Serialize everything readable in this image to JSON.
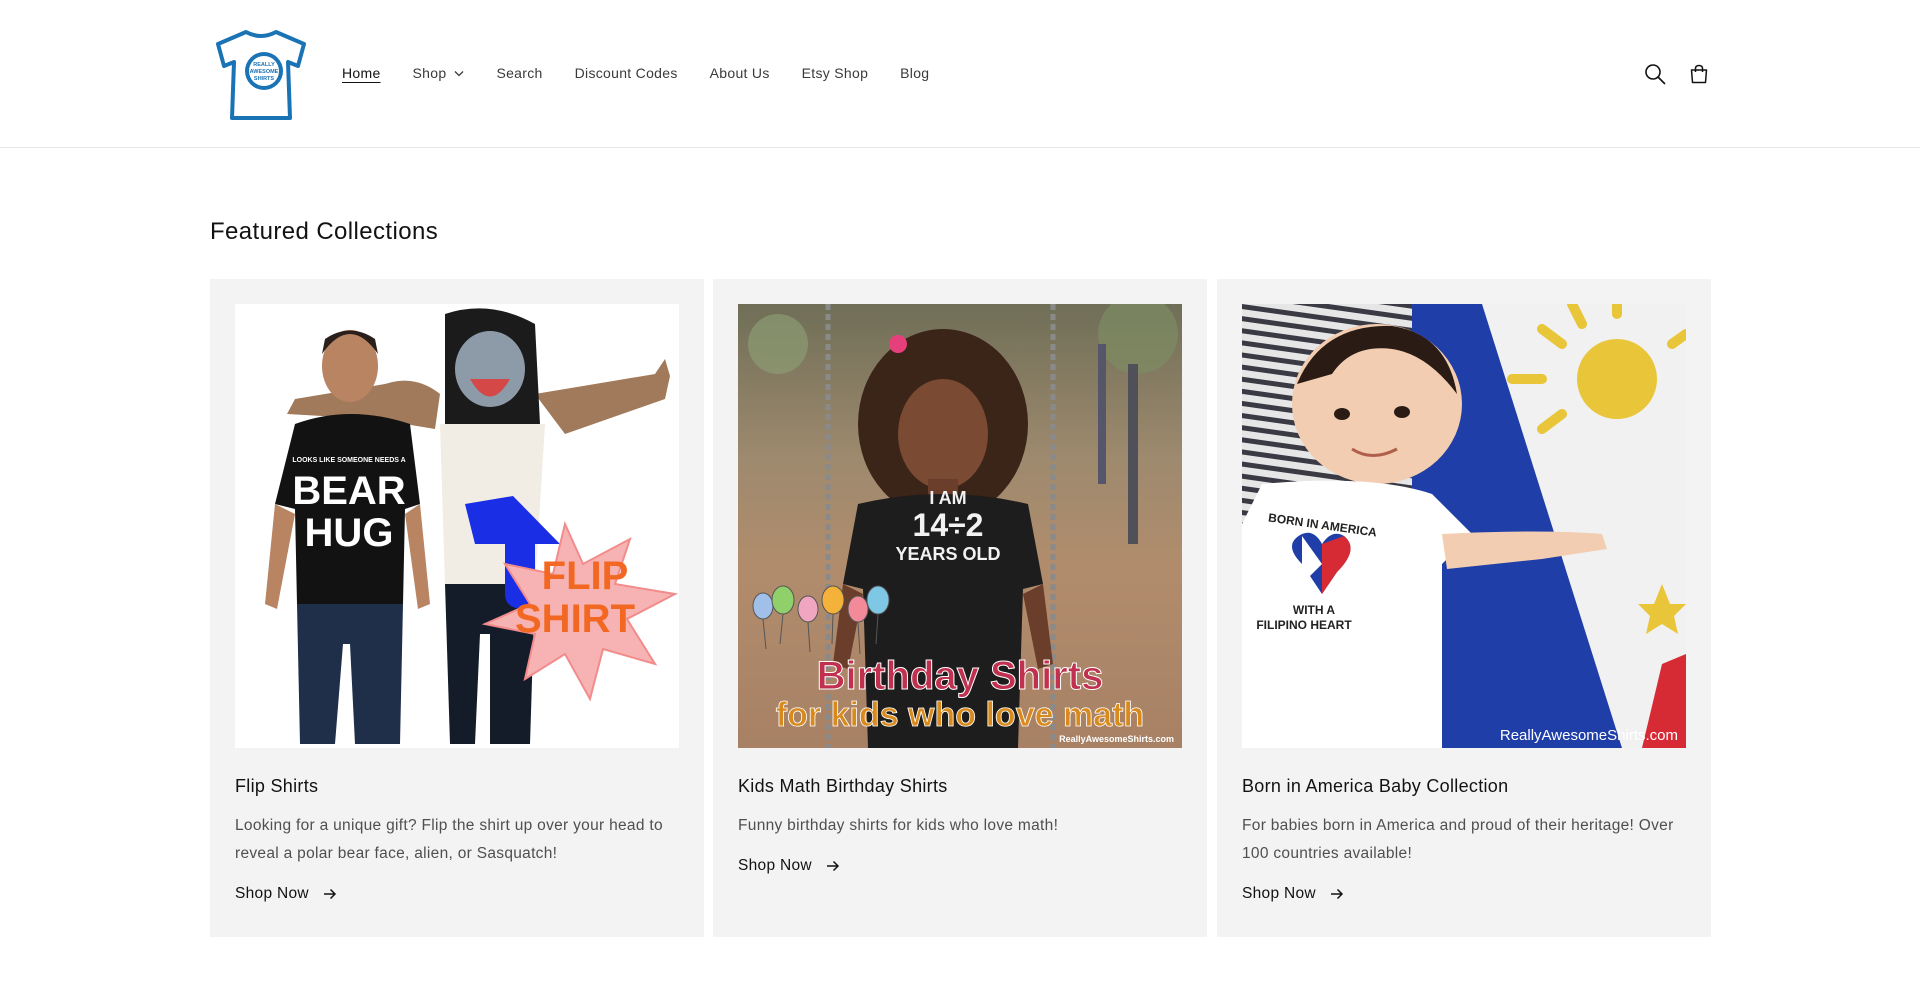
{
  "header": {
    "logo_text": [
      "REALLY",
      "AWESOME",
      "SHIRTS"
    ],
    "nav": [
      {
        "label": "Home",
        "active": true
      },
      {
        "label": "Shop",
        "dropdown": true
      },
      {
        "label": "Search"
      },
      {
        "label": "Discount Codes"
      },
      {
        "label": "About Us"
      },
      {
        "label": "Etsy Shop"
      },
      {
        "label": "Blog"
      }
    ],
    "icons": [
      "search-icon",
      "cart-icon"
    ]
  },
  "main": {
    "section_title": "Featured Collections",
    "collections": [
      {
        "title": "Flip Shirts",
        "description": "Looking for a unique gift? Flip the shirt up over your head to reveal a polar bear face, alien, or Sasquatch!",
        "cta": "Shop Now",
        "image_text": {
          "shirt_small": "LOOKS LIKE SOMEONE NEEDS A",
          "shirt_line1": "BEAR",
          "shirt_line2": "HUG",
          "burst_line1": "FLIP",
          "burst_line2": "SHIRT"
        }
      },
      {
        "title": "Kids Math Birthday Shirts",
        "description": "Funny birthday shirts for kids who love math!",
        "cta": "Shop Now",
        "image_text": {
          "shirt_line1": "I AM",
          "shirt_line2": "14÷2",
          "shirt_line3": "YEARS OLD",
          "banner_line1": "Birthday Shirts",
          "banner_line2": "for kids who love math",
          "watermark": "ReallyAwesomeShirts.com"
        }
      },
      {
        "title": "Born in America Baby Collection",
        "description": "For babies born in America and proud of their heritage! Over 100 countries available!",
        "cta": "Shop Now",
        "image_text": {
          "onesie_line1": "BORN IN AMERICA",
          "onesie_line2": "WITH A",
          "onesie_line3": "FILIPINO HEART",
          "watermark": "ReallyAwesomeShirts.com"
        }
      }
    ]
  },
  "colors": {
    "card_bg": "#f3f3f3",
    "logo_blue": "#1a73b5",
    "arrow_blue": "#1a2ee6",
    "burst_orange": "#f26722",
    "flag_blue": "#1f3ea8",
    "flag_red": "#d62b35",
    "sun_yellow": "#e9c53a",
    "banner_pink": "#c0304f"
  }
}
